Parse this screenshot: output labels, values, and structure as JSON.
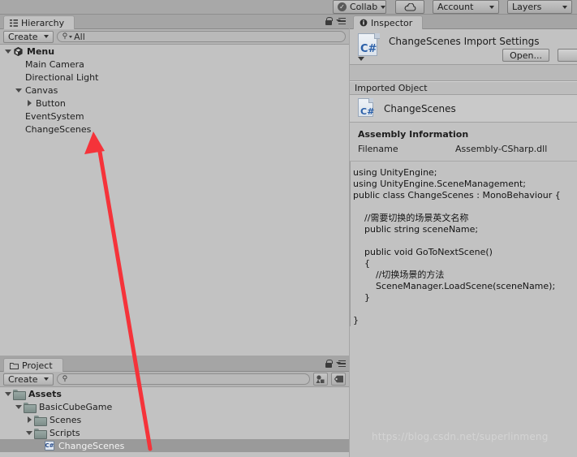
{
  "toolbar": {
    "collab_label": "Collab",
    "collab_icon": "check-circle-icon",
    "cloud_icon": "cloud-icon",
    "account_label": "Account",
    "layers_label": "Layers"
  },
  "hierarchy": {
    "tab_label": "Hierarchy",
    "tab_icon": "hierarchy-icon",
    "create_label": "Create",
    "search_value": "All",
    "search_placeholder": "",
    "lock_icon": "lock-icon",
    "menu_icon": "hamburger-menu-icon",
    "items": [
      {
        "label": "Menu",
        "depth": 0,
        "expander": "down",
        "icon": "unity-scene-icon",
        "bold": true,
        "selected": false
      },
      {
        "label": "Main Camera",
        "depth": 1,
        "expander": "none",
        "icon": "",
        "bold": false,
        "selected": false
      },
      {
        "label": "Directional Light",
        "depth": 1,
        "expander": "none",
        "icon": "",
        "bold": false,
        "selected": false
      },
      {
        "label": "Canvas",
        "depth": 1,
        "expander": "down",
        "icon": "",
        "bold": false,
        "selected": false
      },
      {
        "label": "Button",
        "depth": 2,
        "expander": "right",
        "icon": "",
        "bold": false,
        "selected": false
      },
      {
        "label": "EventSystem",
        "depth": 1,
        "expander": "none",
        "icon": "",
        "bold": false,
        "selected": false
      },
      {
        "label": "ChangeScenes",
        "depth": 1,
        "expander": "none",
        "icon": "",
        "bold": false,
        "selected": false
      }
    ]
  },
  "project": {
    "tab_label": "Project",
    "tab_icon": "folder-icon",
    "create_label": "Create",
    "search_value": "",
    "lock_icon": "lock-icon",
    "menu_icon": "hamburger-menu-icon",
    "filter_type_icon": "filter-by-type-icon",
    "filter_label_icon": "filter-by-label-icon",
    "items": [
      {
        "label": "Assets",
        "depth": 0,
        "expander": "down",
        "icon": "folder-icon",
        "bold": true,
        "selected": false
      },
      {
        "label": "BasicCubeGame",
        "depth": 1,
        "expander": "down",
        "icon": "folder-icon",
        "bold": false,
        "selected": false
      },
      {
        "label": "Scenes",
        "depth": 2,
        "expander": "right",
        "icon": "folder-icon",
        "bold": false,
        "selected": false
      },
      {
        "label": "Scripts",
        "depth": 2,
        "expander": "down",
        "icon": "folder-icon",
        "bold": false,
        "selected": false
      },
      {
        "label": "ChangeScenes",
        "depth": 3,
        "expander": "none",
        "icon": "csharp-file-icon",
        "bold": false,
        "selected": true
      }
    ]
  },
  "inspector": {
    "tab_label": "Inspector",
    "tab_icon": "info-icon",
    "lock_icon": "lock-icon",
    "menu_icon": "hamburger-menu-icon",
    "import_settings_title": "ChangeScenes Import Settings",
    "file_icon": "csharp-file-icon",
    "open_button": "Open...",
    "imported_object_section": "Imported Object",
    "imported_object_name": "ChangeScenes",
    "assembly_title": "Assembly Information",
    "assembly_filename_key": "Filename",
    "assembly_filename_value": "Assembly-CSharp.dll",
    "code": "using UnityEngine;\nusing UnityEngine.SceneManagement;\npublic class ChangeScenes : MonoBehaviour {\n\n    //需要切换的场景英文名称\n    public string sceneName;\n\n    public void GoToNextScene()\n    {\n        //切换场景的方法\n        SceneManager.LoadScene(sceneName);\n    }\n\n}"
  },
  "annotation": {
    "arrow_color": "#f5333a",
    "arrow_name": "red-annotation-arrow"
  },
  "watermark": {
    "text": "https://blog.csdn.net/superlinmeng"
  }
}
